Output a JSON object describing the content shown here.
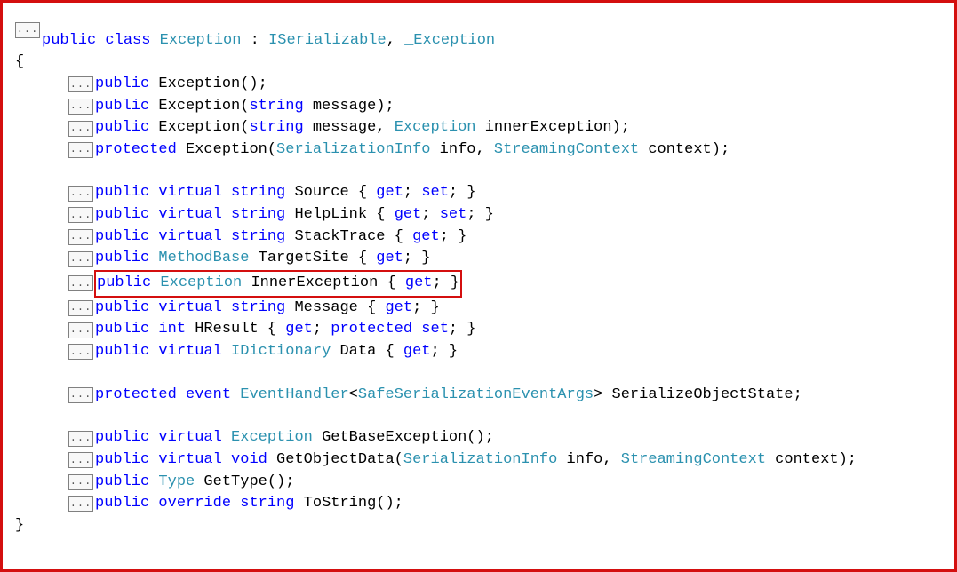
{
  "fold_label": "...",
  "header": {
    "kw_public": "public",
    "kw_class": "class",
    "type_exception": "Exception",
    "colon": " : ",
    "type_iserializable": "ISerializable",
    "comma": ", ",
    "type_exception_iface": "_Exception"
  },
  "open_brace": "{",
  "close_brace": "}",
  "ctor1": {
    "public": "public",
    "name": " Exception();"
  },
  "ctor2": {
    "public": "public",
    "name": " Exception(",
    "string": "string",
    "rest": " message);"
  },
  "ctor3": {
    "public": "public",
    "name": " Exception(",
    "string": "string",
    "msg": " message, ",
    "exc": "Exception",
    "rest": " innerException);"
  },
  "ctor4": {
    "protected": "protected",
    "name": " Exception(",
    "si": "SerializationInfo",
    "info": " info, ",
    "sc": "StreamingContext",
    "rest": " context);"
  },
  "prop_source": {
    "public": "public",
    "virtual": "virtual",
    "string": "string",
    "name": " Source { ",
    "get": "get",
    "s": "; ",
    "set": "set",
    "end": "; }"
  },
  "prop_helplink": {
    "public": "public",
    "virtual": "virtual",
    "string": "string",
    "name": " HelpLink { ",
    "get": "get",
    "s": "; ",
    "set": "set",
    "end": "; }"
  },
  "prop_stacktrace": {
    "public": "public",
    "virtual": "virtual",
    "string": "string",
    "name": " StackTrace { ",
    "get": "get",
    "end": "; }"
  },
  "prop_targetsite": {
    "public": "public",
    "mb": "MethodBase",
    "name": " TargetSite { ",
    "get": "get",
    "end": "; }"
  },
  "prop_inner": {
    "public": "public",
    "exc": "Exception",
    "name": " InnerException { ",
    "get": "get",
    "end": "; }"
  },
  "prop_message": {
    "public": "public",
    "virtual": "virtual",
    "string": "string",
    "name": " Message { ",
    "get": "get",
    "end": "; }"
  },
  "prop_hresult": {
    "public": "public",
    "int": "int",
    "name": " HResult { ",
    "get": "get",
    "s": "; ",
    "protected": "protected",
    "sp": " ",
    "set": "set",
    "end": "; }"
  },
  "prop_data": {
    "public": "public",
    "virtual": "virtual",
    "idict": "IDictionary",
    "name": " Data { ",
    "get": "get",
    "end": "; }"
  },
  "event_line": {
    "protected": "protected",
    "event": "event",
    "eh": "EventHandler",
    "lt": "<",
    "args": "SafeSerializationEventArgs",
    "gt": ">",
    "rest": " SerializeObjectState;"
  },
  "m_getbase": {
    "public": "public",
    "virtual": "virtual",
    "exc": "Exception",
    "rest": " GetBaseException();"
  },
  "m_getobj": {
    "public": "public",
    "virtual": "virtual",
    "void": "void",
    "name": " GetObjectData(",
    "si": "SerializationInfo",
    "info": " info, ",
    "sc": "StreamingContext",
    "rest": " context);"
  },
  "m_gettype": {
    "public": "public",
    "type": "Type",
    "rest": " GetType();"
  },
  "m_tostring": {
    "public": "public",
    "override": "override",
    "string": "string",
    "rest": " ToString();"
  }
}
